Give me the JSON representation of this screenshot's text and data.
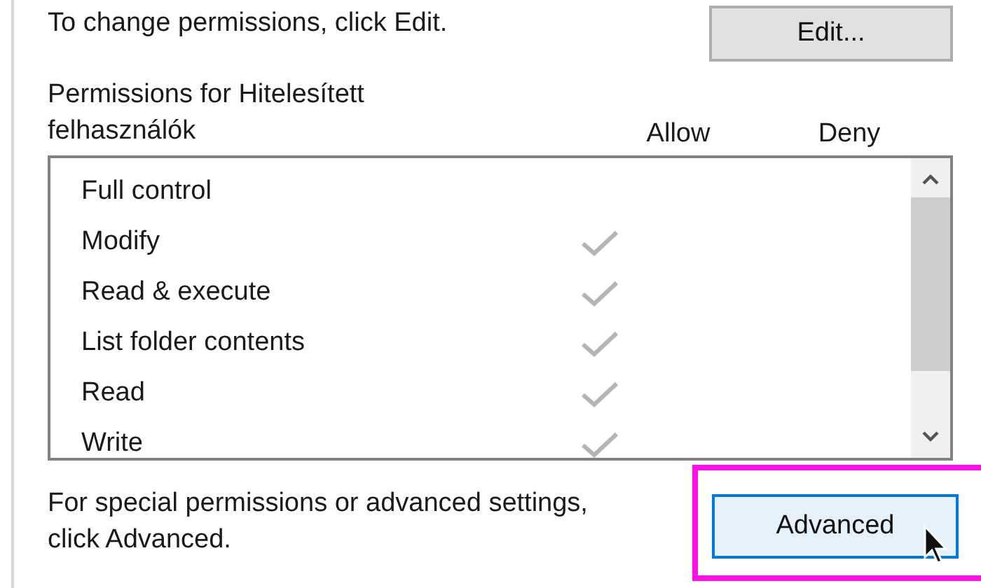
{
  "edit_prompt": "To change permissions, click Edit.",
  "edit_button": "Edit...",
  "permissions_label": "Permissions for Hitelesített felhasználók",
  "columns": [
    "Allow",
    "Deny"
  ],
  "permissions": [
    {
      "name": "Full control",
      "allow": false,
      "deny": false
    },
    {
      "name": "Modify",
      "allow": true,
      "deny": false
    },
    {
      "name": "Read & execute",
      "allow": true,
      "deny": false
    },
    {
      "name": "List folder contents",
      "allow": true,
      "deny": false
    },
    {
      "name": "Read",
      "allow": true,
      "deny": false
    },
    {
      "name": "Write",
      "allow": true,
      "deny": false
    }
  ],
  "advanced_prompt": "For special permissions or advanced settings, click Advanced.",
  "advanced_button": {
    "label": "Advanced",
    "highlighted": true
  }
}
